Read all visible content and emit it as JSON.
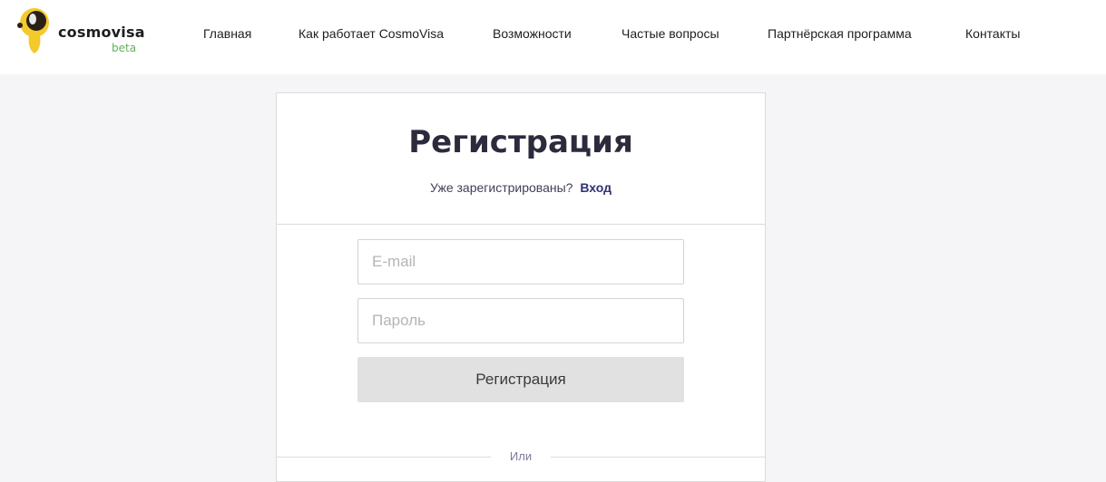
{
  "header": {
    "logo": {
      "name": "cosmovisa",
      "badge": "beta",
      "icon": "astronaut-helmet-icon",
      "colors": {
        "helmet": "#f4c92b",
        "visor": "#2a2116",
        "badge": "#63b15c"
      }
    },
    "nav": [
      {
        "label": "Главная"
      },
      {
        "label": "Как работает CosmoVisa"
      },
      {
        "label": "Возможности"
      },
      {
        "label": "Частые вопросы"
      },
      {
        "label": "Партнёрская программа"
      },
      {
        "label": "Контакты"
      }
    ]
  },
  "form": {
    "title": "Регистрация",
    "already_registered": "Уже зарегистрированы?",
    "login_link": "Вход",
    "email_placeholder": "E-mail",
    "password_placeholder": "Пароль",
    "submit_label": "Регистрация",
    "divider_label": "Или"
  }
}
